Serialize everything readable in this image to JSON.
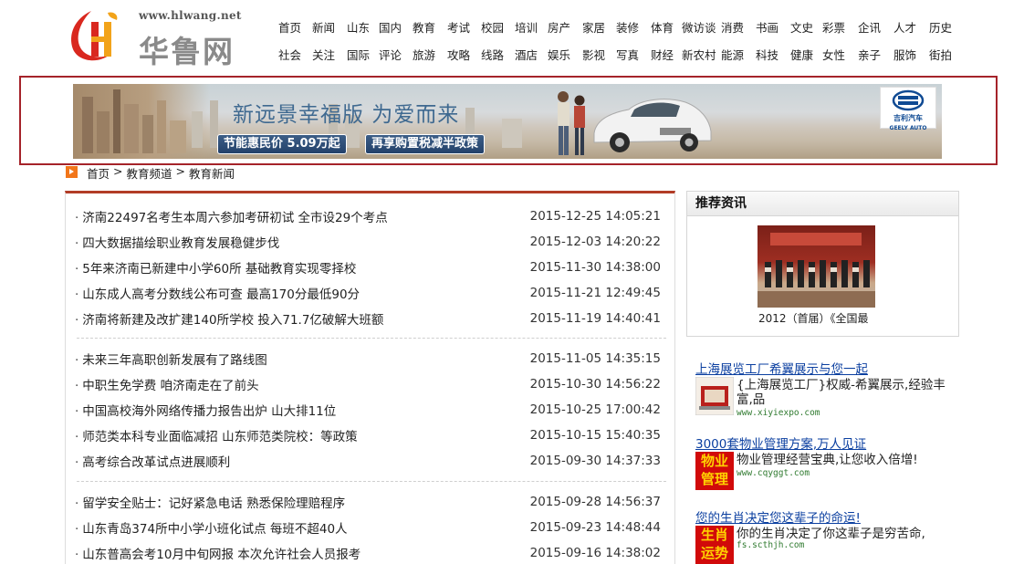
{
  "site": {
    "url": "www.hlwang.net",
    "name": "华鲁网"
  },
  "nav": {
    "row1": [
      "首页",
      "新闻",
      "山东",
      "国内",
      "教育",
      "考试",
      "校园",
      "培训",
      "房产",
      "家居",
      "装修",
      "体育",
      "微访谈",
      "消费",
      "书画",
      "文史",
      "彩票",
      "企讯",
      "人才",
      "历史"
    ],
    "row2": [
      "社会",
      "关注",
      "国际",
      "评论",
      "旅游",
      "攻略",
      "线路",
      "酒店",
      "娱乐",
      "影视",
      "写真",
      "财经",
      "新农村",
      "能源",
      "科技",
      "健康",
      "女性",
      "亲子",
      "服饰",
      "街拍"
    ]
  },
  "banner": {
    "title": "新远景幸福版 为爱而来",
    "tag1": "节能惠民价 5.09万起",
    "tag2": "再享购置税减半政策",
    "brand": "GEELY AUTO",
    "brand_cn": "吉利汽车"
  },
  "breadcrumb": [
    "首页",
    ">",
    "教育频道",
    ">",
    "教育新闻"
  ],
  "news_groups": [
    [
      {
        "title": "济南22497名考生本周六参加考研初试 全市设29个考点",
        "time": "2015-12-25 14:05:21"
      },
      {
        "title": "四大数据描绘职业教育发展稳健步伐",
        "time": "2015-12-03 14:20:22"
      },
      {
        "title": "5年来济南已新建中小学60所 基础教育实现零择校",
        "time": "2015-11-30 14:38:00"
      },
      {
        "title": "山东成人高考分数线公布可查 最高170分最低90分",
        "time": "2015-11-21 12:49:45"
      },
      {
        "title": "济南将新建及改扩建140所学校 投入71.7亿破解大班额",
        "time": "2015-11-19 14:40:41"
      }
    ],
    [
      {
        "title": "未来三年高职创新发展有了路线图",
        "time": "2015-11-05 14:35:15"
      },
      {
        "title": "中职生免学费 咱济南走在了前头",
        "time": "2015-10-30 14:56:22"
      },
      {
        "title": "中国高校海外网络传播力报告出炉 山大排11位",
        "time": "2015-10-25 17:00:42"
      },
      {
        "title": "师范类本科专业面临减招 山东师范类院校：等政策",
        "time": "2015-10-15 15:40:35"
      },
      {
        "title": "高考综合改革试点进展顺利",
        "time": "2015-09-30 14:37:33"
      }
    ],
    [
      {
        "title": "留学安全贴士：记好紧急电话 熟悉保险理赔程序",
        "time": "2015-09-28 14:56:37"
      },
      {
        "title": "山东青岛374所中小学小班化试点 每班不超40人",
        "time": "2015-09-23 14:48:44"
      },
      {
        "title": "山东普高会考10月中旬网报 本次允许社会人员报考",
        "time": "2015-09-16 14:38:02"
      }
    ]
  ],
  "recommend": {
    "heading": "推荐资讯",
    "caption": "2012（首届）《全国最"
  },
  "ads": [
    {
      "link": "上海展览工厂希翼展示与您一起",
      "desc": "{上海展览工厂}权威-希翼展示,经验丰富,品",
      "url": "www.xiyiexpo.com"
    },
    {
      "link": "3000套物业管理方案,万人见证",
      "desc": "物业管理经营宝典,让您收入倍增!",
      "url": "www.cqyggt.com",
      "badge": "物业管理"
    },
    {
      "link": "您的生肖决定您这辈子的命运!",
      "desc": "你的生肖决定了你这辈子是穷苦命,",
      "url": "fs.scthjh.com",
      "badge": "生肖运势"
    }
  ],
  "colors": {
    "accent_red": "#b23c26",
    "banner_border": "#a5232a",
    "link_blue": "#0b3fa0",
    "logo_orange": "#f2761a"
  }
}
